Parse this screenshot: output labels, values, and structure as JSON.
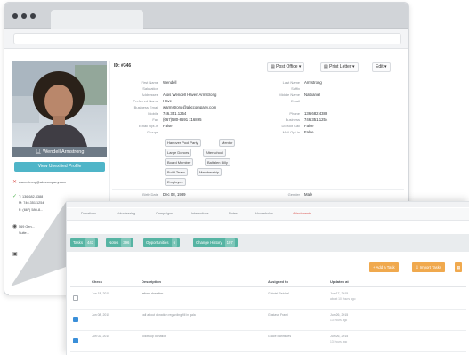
{
  "contact": {
    "full_name": "Wendell Armstrong",
    "view_profile_label": "View Unexified Profile",
    "email": "warmstrong@abccompany.com",
    "phone_t": "T: 136.682.4388",
    "phone_m": "M: 746.351.1254",
    "phone_f": "F: (667) 580-8...",
    "address_l1": "569 Gen...",
    "address_l2": "Suite..."
  },
  "record": {
    "id_label": "ID: #346",
    "post_office_label": "Post Office",
    "print_letter_label": "Print Letter",
    "edit_label": "Edit"
  },
  "fields_left": [
    {
      "label": "First Name",
      "value": "Wendell"
    },
    {
      "label": "Salutation",
      "value": ""
    },
    {
      "label": "Addressee",
      "value": "Alois Wendell Haven Armstrong"
    },
    {
      "label": "Preferred Name",
      "value": "Have"
    },
    {
      "label": "Business Email",
      "value": "warmstrong@abccompany.com"
    },
    {
      "label": "Mobile",
      "value": "746.351.1254"
    },
    {
      "label": "Fax",
      "value": "(667)580-8591 x16895"
    },
    {
      "label": "Email Opt-in",
      "value": "False"
    },
    {
      "label": "Groups",
      "value": ""
    }
  ],
  "fields_right": [
    {
      "label": "Last Name",
      "value": "Armstrong"
    },
    {
      "label": "Suffix",
      "value": ""
    },
    {
      "label": "Middle Name",
      "value": "Nathaniel"
    },
    {
      "label": "Email",
      "value": ""
    },
    {
      "label": "Phone",
      "value": "136.682.4388"
    },
    {
      "label": "Business",
      "value": "746.351.1254"
    },
    {
      "label": "Do Not Call",
      "value": "False"
    },
    {
      "label": "Mail Opt-in",
      "value": "False"
    }
  ],
  "groups": [
    "Hanover Pool Party",
    "Mentor",
    "Large Donors",
    "Afterschool",
    "Board Member",
    "Baltalen Billy",
    "Build Team",
    "Membership",
    "Employee"
  ],
  "birth": {
    "label": "Birth Date",
    "value": "Dec 08, 1989"
  },
  "gender": {
    "label": "Gender",
    "value": "Male"
  },
  "overlay": {
    "tabs": [
      "Donations",
      "Volunteering",
      "Campaigns",
      "Interactions",
      "Notes",
      "Households",
      "Attachments"
    ],
    "summary": [
      {
        "label": "Tasks",
        "count": "443"
      },
      {
        "label": "Notes",
        "count": "396"
      },
      {
        "label": "Opportunities",
        "count": "6"
      },
      {
        "label": "Change History",
        "count": "107"
      }
    ],
    "add_task_label": "+ Add a Task",
    "import_tasks_label": "Import Tasks",
    "columns": [
      "Check",
      "Description",
      "Assigned to",
      "Updated at"
    ],
    "rows": [
      {
        "checked": false,
        "check": "Jun 18, 2015",
        "desc": "refund donation",
        "assigned": "Gabriel Reichel",
        "updated": "Jun 17, 2015",
        "sub": "about 10 hours ago"
      },
      {
        "checked": true,
        "check": "Jun 08, 2015",
        "desc": "call about donation regarding fill in gala",
        "assigned": "Gustave Frami",
        "updated": "Jun 26, 2015",
        "sub": "13 hours ago"
      },
      {
        "checked": true,
        "check": "Jun 02, 2015",
        "desc": "follow up donation",
        "assigned": "Grace Bahnsdes",
        "updated": "Jun 26, 2015",
        "sub": "13 hours ago"
      }
    ]
  },
  "colors": {
    "accent_teal": "#56b4a3",
    "accent_orange": "#f0a94e",
    "profile_blue": "#4fb5c8"
  }
}
